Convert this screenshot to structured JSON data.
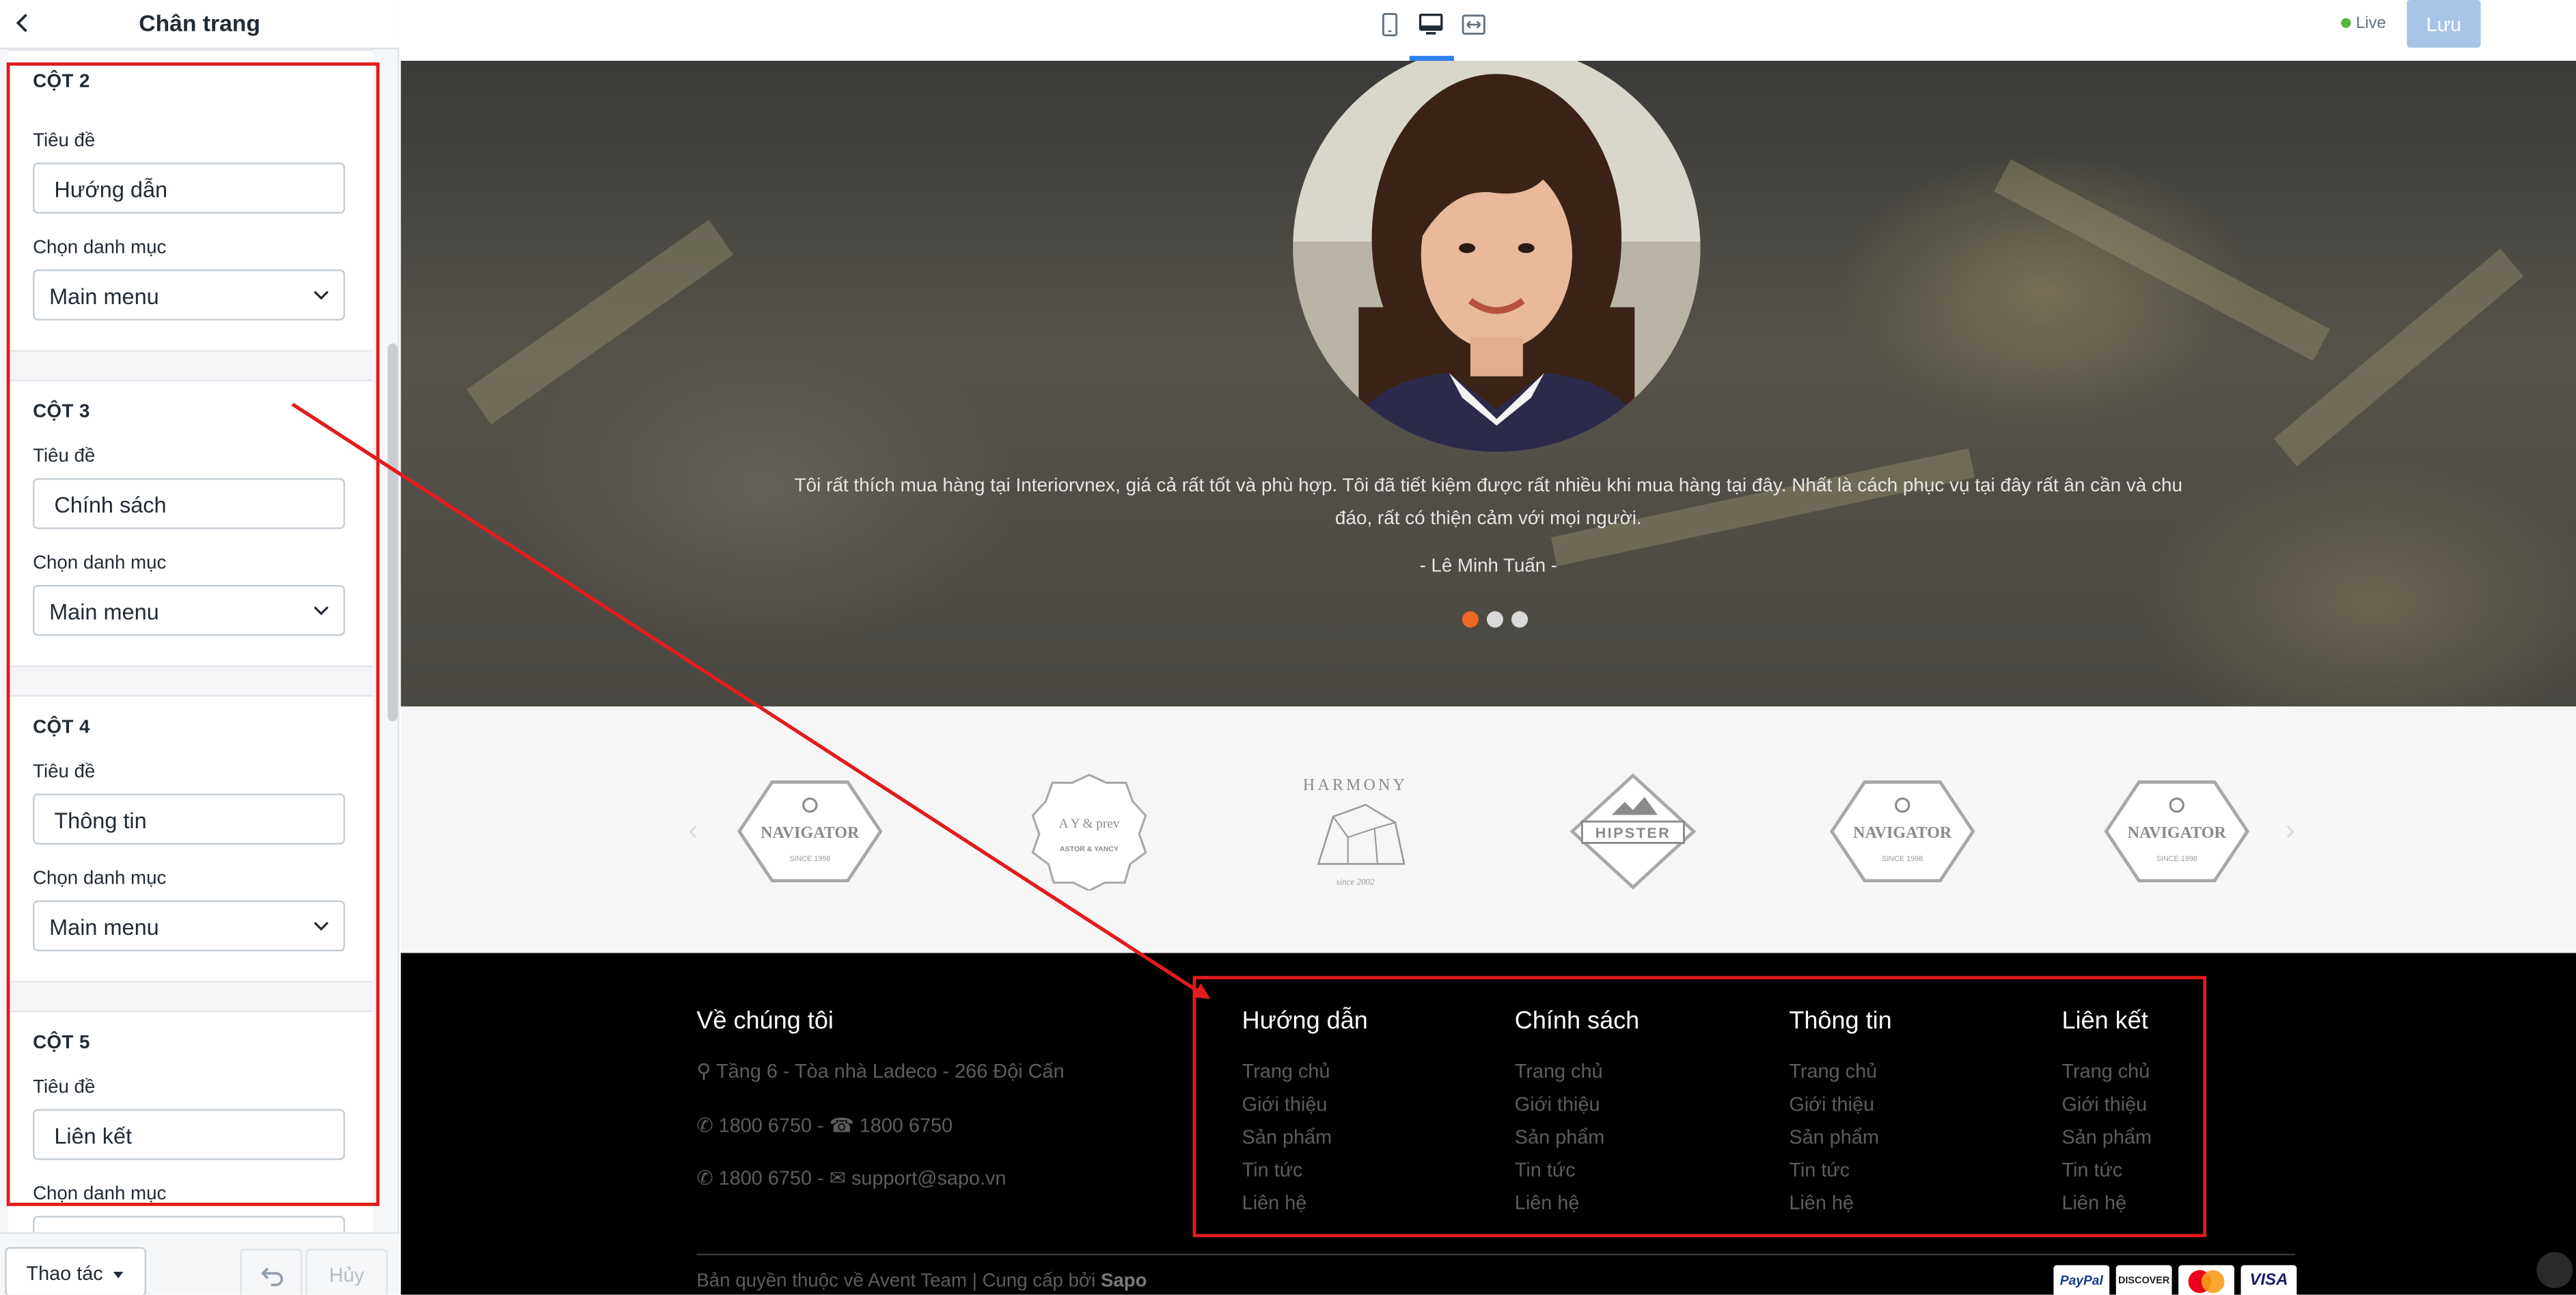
{
  "panel": {
    "title": "Chân trang",
    "columns": [
      {
        "heading": "CỘT 2",
        "title_label": "Tiêu đề",
        "title_value": "Hướng dẫn",
        "menu_label": "Chọn danh mục",
        "menu_value": "Main menu"
      },
      {
        "heading": "CỘT 3",
        "title_label": "Tiêu đề",
        "title_value": "Chính sách",
        "menu_label": "Chọn danh mục",
        "menu_value": "Main menu"
      },
      {
        "heading": "CỘT 4",
        "title_label": "Tiêu đề",
        "title_value": "Thông tin",
        "menu_label": "Chọn danh mục",
        "menu_value": "Main menu"
      },
      {
        "heading": "CỘT 5",
        "title_label": "Tiêu đề",
        "title_value": "Liên kết",
        "menu_label": "Chọn danh mục",
        "menu_value": ""
      }
    ],
    "footer": {
      "actions_label": "Thao tác",
      "cancel_label": "Hủy"
    }
  },
  "topbar": {
    "devices": [
      "mobile-icon",
      "desktop-icon",
      "fullwidth-icon"
    ],
    "active_device": "desktop",
    "live_label": "Live",
    "save_label": "Lưu"
  },
  "testimonial": {
    "quote": "Tôi rất thích mua hàng tại Interiorvnex, giá cả rất tốt và phù hợp. Tôi đã tiết kiệm được rất nhiều khi mua hàng tại đây. Nhất là cách phục vụ tại đây rất ân cần và chu đáo, rất có thiện cảm với mọi người.",
    "author": "- Lê Minh Tuấn -",
    "slides_total": 3,
    "active_slide": 1,
    "active_color": "#f26522"
  },
  "brands": {
    "logos": [
      {
        "name": "NAVIGATOR",
        "sub": "SINCE 1998"
      },
      {
        "name": "ASTOR & YANCY",
        "sub": "A Y & prev"
      },
      {
        "name": "HARMONY",
        "sub": "since 2002"
      },
      {
        "name": "HIPSTER",
        "sub": ""
      },
      {
        "name": "NAVIGATOR",
        "sub": "SINCE 1998"
      },
      {
        "name": "NAVIGATOR",
        "sub": "SINCE 1998"
      }
    ]
  },
  "footer": {
    "about": {
      "title": "Về chúng tôi",
      "address": "Tầng 6 - Tòa nhà Ladeco - 266 Đội Cấn",
      "phone1": "1800 6750 -",
      "phone2": "1800 6750",
      "phone3": "1800 6750 -",
      "email": "support@sapo.vn"
    },
    "columns": [
      {
        "title": "Hướng dẫn",
        "links": [
          "Trang chủ",
          "Giới thiệu",
          "Sản phẩm",
          "Tin tức",
          "Liên hệ"
        ]
      },
      {
        "title": "Chính sách",
        "links": [
          "Trang chủ",
          "Giới thiệu",
          "Sản phẩm",
          "Tin tức",
          "Liên hệ"
        ]
      },
      {
        "title": "Thông tin",
        "links": [
          "Trang chủ",
          "Giới thiệu",
          "Sản phẩm",
          "Tin tức",
          "Liên hệ"
        ]
      },
      {
        "title": "Liên kết",
        "links": [
          "Trang chủ",
          "Giới thiệu",
          "Sản phẩm",
          "Tin tức",
          "Liên hệ"
        ]
      }
    ],
    "copyright_prefix": "Bản quyền thuộc về Avent Team | Cung cấp bởi ",
    "copyright_brand": "Sapo",
    "payments": [
      "PayPal",
      "DISCOVER",
      "Mastercard",
      "VISA"
    ]
  },
  "colors": {
    "annotation": "#e21b1b",
    "accent": "#2f80ed",
    "save_button": "#a7c6e7"
  }
}
